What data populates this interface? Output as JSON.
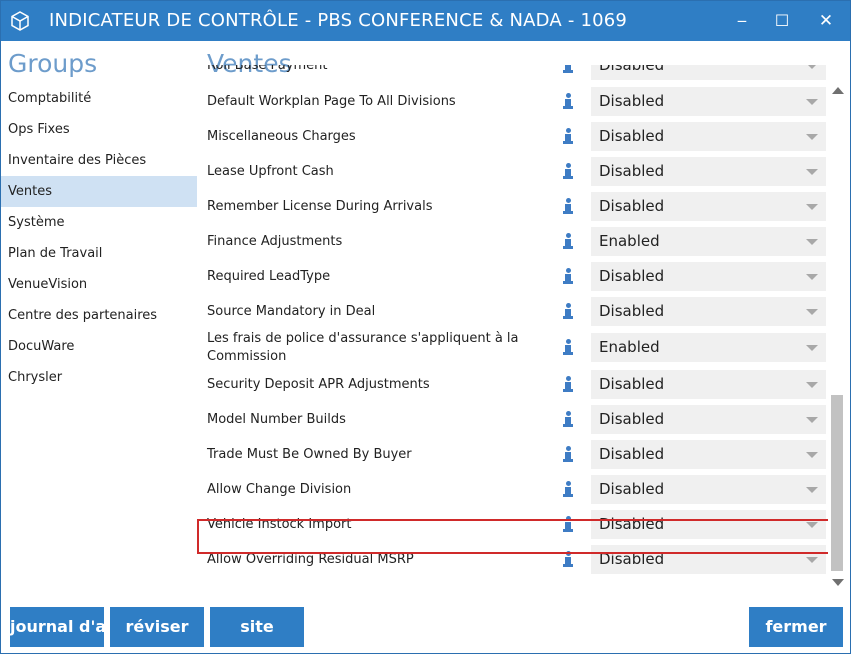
{
  "window": {
    "title": "INDICATEUR DE CONTRÔLE - PBS CONFERENCE & NADA - 1069",
    "minimize": "‒",
    "maximize": "☐",
    "close": "✕"
  },
  "groups": {
    "title": "Groups",
    "items": [
      {
        "label": "Comptabilité",
        "selected": false
      },
      {
        "label": "Ops Fixes",
        "selected": false
      },
      {
        "label": "Inventaire des Pièces",
        "selected": false
      },
      {
        "label": "Ventes",
        "selected": true
      },
      {
        "label": "Système",
        "selected": false
      },
      {
        "label": "Plan de Travail",
        "selected": false
      },
      {
        "label": "VenueVision",
        "selected": false
      },
      {
        "label": "Centre des partenaires",
        "selected": false
      },
      {
        "label": "DocuWare",
        "selected": false
      },
      {
        "label": "Chrysler",
        "selected": false
      }
    ]
  },
  "section": {
    "title": "Ventes"
  },
  "settings": [
    {
      "label": "Roll Base Payment",
      "value": "Disabled"
    },
    {
      "label": "Default Workplan Page To All Divisions",
      "value": "Disabled"
    },
    {
      "label": "Miscellaneous Charges",
      "value": "Disabled"
    },
    {
      "label": "Lease Upfront Cash",
      "value": "Disabled"
    },
    {
      "label": "Remember License During Arrivals",
      "value": "Disabled"
    },
    {
      "label": "Finance Adjustments",
      "value": "Enabled"
    },
    {
      "label": "Required LeadType",
      "value": "Disabled"
    },
    {
      "label": "Source Mandatory in Deal",
      "value": "Disabled"
    },
    {
      "label": "Les frais de police d'assurance s'appliquent à la Commission",
      "value": "Enabled"
    },
    {
      "label": "Security Deposit APR Adjustments",
      "value": "Disabled"
    },
    {
      "label": "Model Number Builds",
      "value": "Disabled"
    },
    {
      "label": "Trade Must Be Owned By Buyer",
      "value": "Disabled"
    },
    {
      "label": "Allow Change Division",
      "value": "Disabled"
    },
    {
      "label": "Vehicle Instock Import",
      "value": "Disabled"
    },
    {
      "label": "Allow Overriding Residual MSRP",
      "value": "Disabled"
    }
  ],
  "buttons": {
    "journal": "journal d'a",
    "reviser": "réviser",
    "site": "site",
    "fermer": "fermer"
  },
  "colors": {
    "accent": "#2f7ec5",
    "selected_group": "#cfe1f3",
    "highlight_border": "#d02a2a",
    "section_title": "#6d9ccb"
  }
}
